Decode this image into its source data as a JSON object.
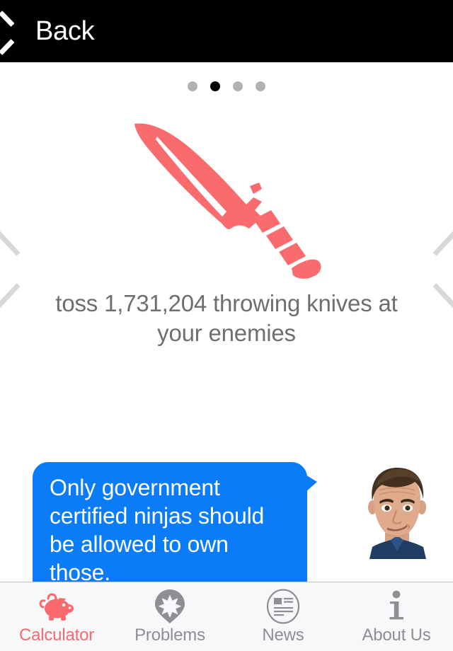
{
  "navbar": {
    "back_label": "Back",
    "background_color": "#000000",
    "text_color": "#ffffff"
  },
  "carousel": {
    "dots": [
      {
        "active": false
      },
      {
        "active": true
      },
      {
        "active": false
      },
      {
        "active": false
      }
    ],
    "dot_count": 4,
    "active_index": 1,
    "prev_label": "Previous",
    "next_label": "Next",
    "illustration_name": "throwing-knife",
    "illustration_color": "#fa6b6e",
    "caption": "toss 1,731,204 throwing knives at your enemies",
    "caption_number": "1,731,204",
    "caption_color": "#6e6e6e"
  },
  "message": {
    "text": "Only government certified ninjas should be allowed to own those.",
    "bubble_color": "#0a7cf8",
    "text_color": "#ffffff",
    "avatar_name": "person-photo-avatar"
  },
  "tabbar": {
    "active_index": 0,
    "active_color": "#f9696d",
    "inactive_color": "#8e8e93",
    "background_color": "#f7f8fa",
    "items": [
      {
        "label": "Calculator",
        "icon": "piggy-bank-icon"
      },
      {
        "label": "Problems",
        "icon": "map-pin-star-icon"
      },
      {
        "label": "News",
        "icon": "newspaper-circle-icon"
      },
      {
        "label": "About Us",
        "icon": "info-i-icon"
      }
    ]
  }
}
